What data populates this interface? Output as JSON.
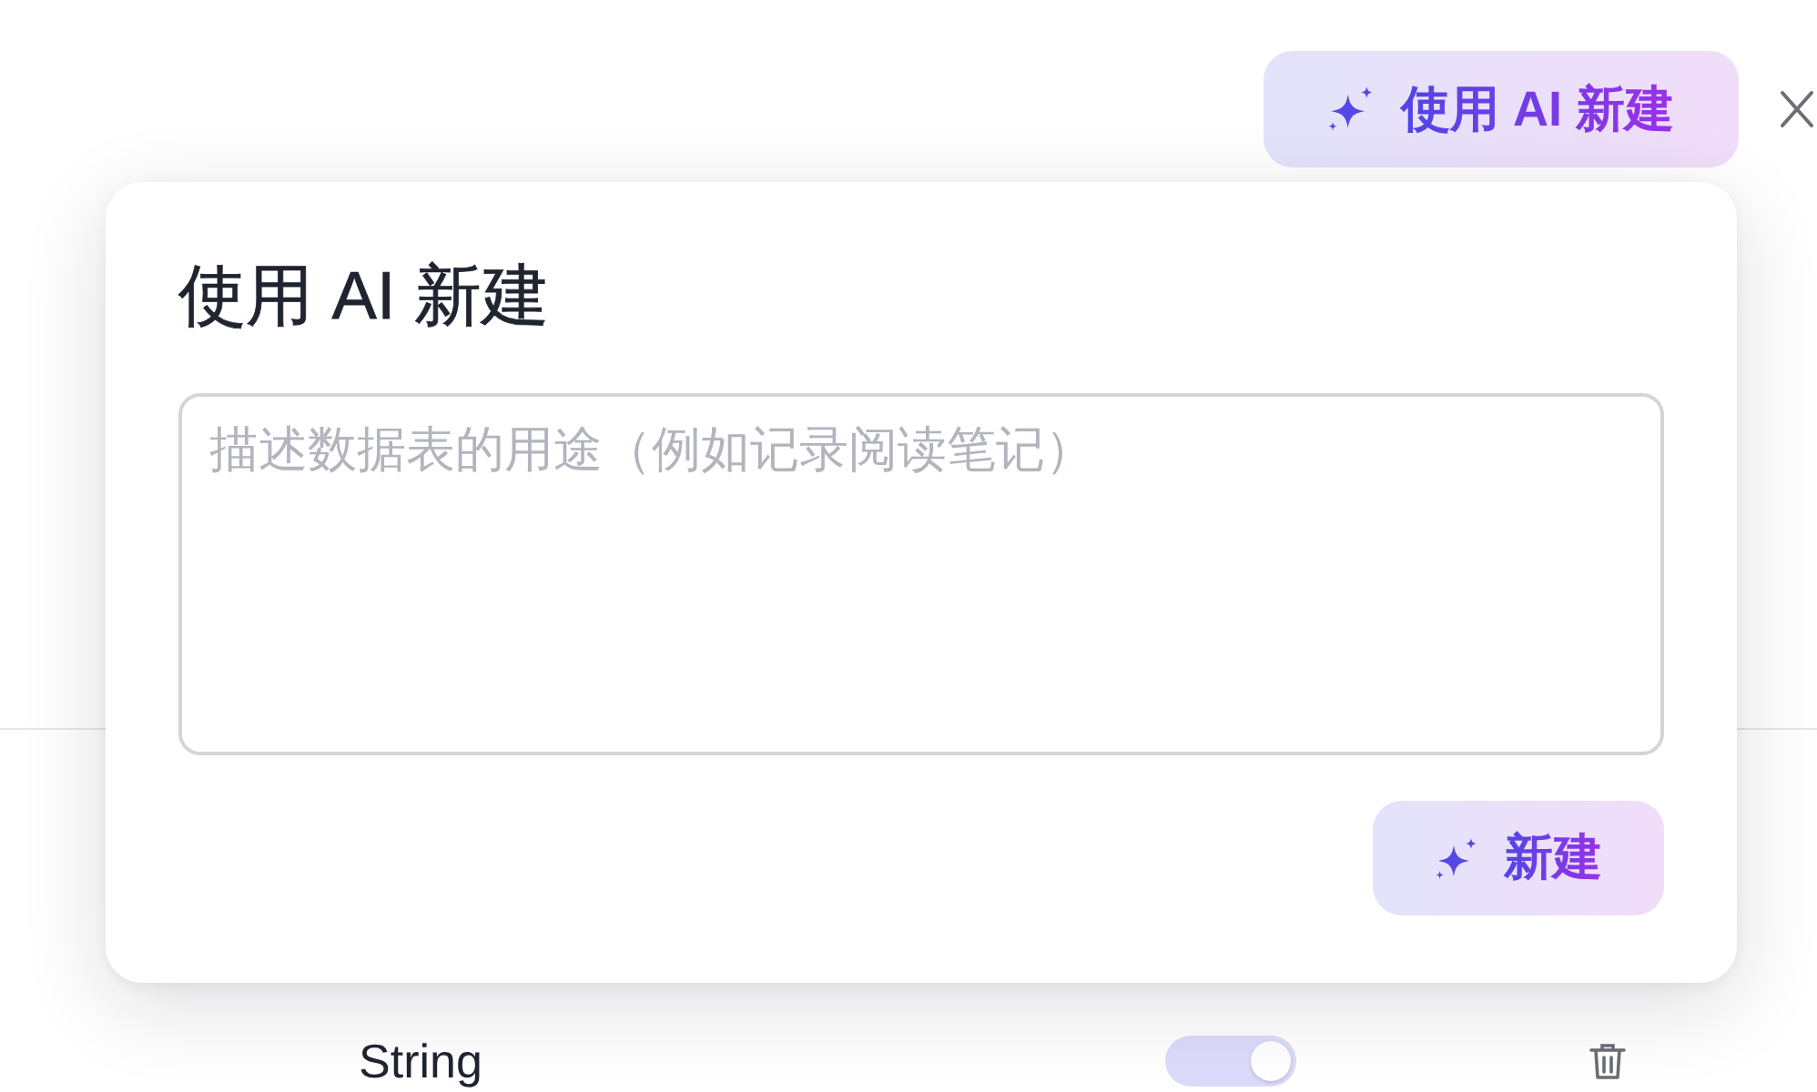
{
  "header": {
    "ai_button": {
      "label": "使用 AI 新建"
    }
  },
  "popover": {
    "title": "使用 AI 新建",
    "prompt": {
      "placeholder": "描述数据表的用途（例如记录阅读笔记）"
    },
    "submit_button": {
      "label": "新建"
    }
  },
  "rows": [
    {
      "type": "String",
      "on": true
    }
  ]
}
